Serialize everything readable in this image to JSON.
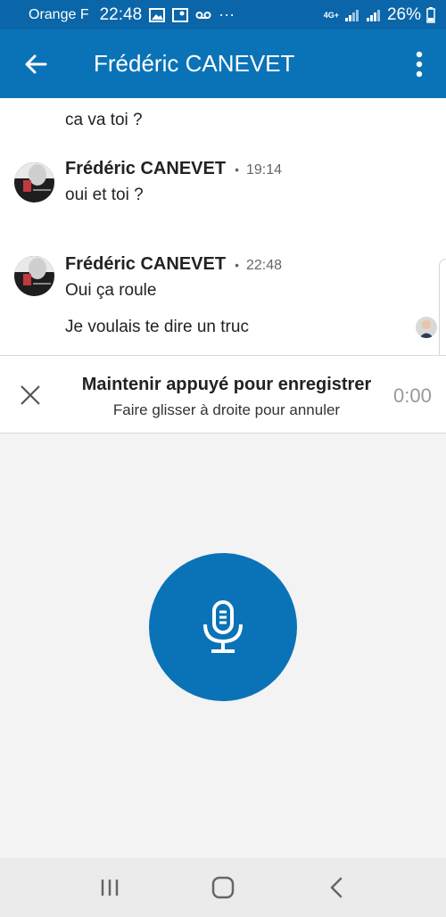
{
  "status_bar": {
    "carrier": "Orange F",
    "time": "22:48",
    "network": "4G+",
    "battery": "26%"
  },
  "header": {
    "title": "Frédéric CANEVET",
    "back_icon": "arrow-left-icon",
    "more_icon": "more-vertical-icon"
  },
  "messages": [
    {
      "text": "ca va toi ?"
    },
    {
      "sender": "Frédéric CANEVET",
      "time": "19:14",
      "text": "oui et toi ?"
    },
    {
      "sender": "Frédéric CANEVET",
      "time": "22:48",
      "text": "Oui ça roule",
      "text2": "Je voulais te dire un truc"
    }
  ],
  "recording": {
    "title": "Maintenir appuyé pour enregistrer",
    "subtitle": "Faire glisser à droite pour annuler",
    "timer": "0:00"
  },
  "mic": {
    "icon": "microphone-icon"
  },
  "colors": {
    "brand": "#0a73b7",
    "status": "#0a66a8"
  }
}
